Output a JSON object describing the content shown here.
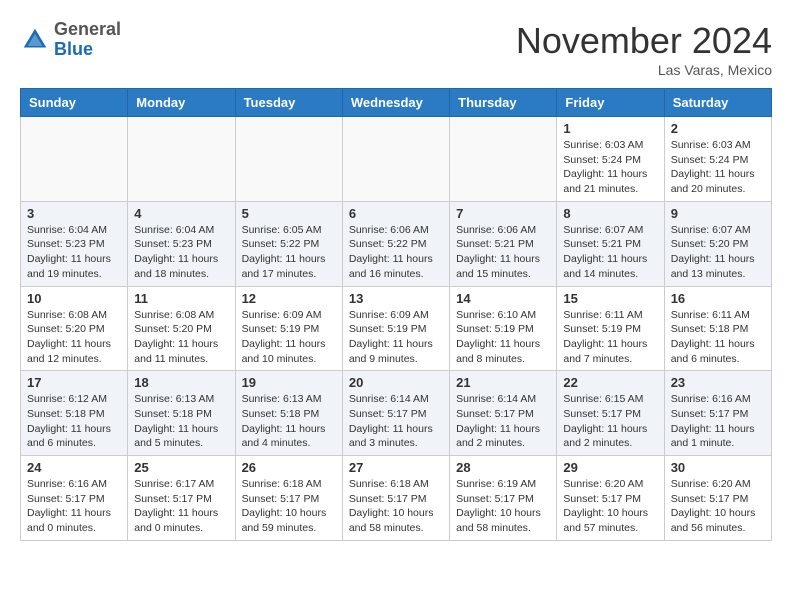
{
  "logo": {
    "general": "General",
    "blue": "Blue"
  },
  "header": {
    "month": "November 2024",
    "location": "Las Varas, Mexico"
  },
  "weekdays": [
    "Sunday",
    "Monday",
    "Tuesday",
    "Wednesday",
    "Thursday",
    "Friday",
    "Saturday"
  ],
  "weeks": [
    {
      "days": [
        {
          "number": "",
          "empty": true
        },
        {
          "number": "",
          "empty": true
        },
        {
          "number": "",
          "empty": true
        },
        {
          "number": "",
          "empty": true
        },
        {
          "number": "",
          "empty": true
        },
        {
          "number": "1",
          "sunrise": "Sunrise: 6:03 AM",
          "sunset": "Sunset: 5:24 PM",
          "daylight": "Daylight: 11 hours and 21 minutes."
        },
        {
          "number": "2",
          "sunrise": "Sunrise: 6:03 AM",
          "sunset": "Sunset: 5:24 PM",
          "daylight": "Daylight: 11 hours and 20 minutes."
        }
      ]
    },
    {
      "days": [
        {
          "number": "3",
          "sunrise": "Sunrise: 6:04 AM",
          "sunset": "Sunset: 5:23 PM",
          "daylight": "Daylight: 11 hours and 19 minutes."
        },
        {
          "number": "4",
          "sunrise": "Sunrise: 6:04 AM",
          "sunset": "Sunset: 5:23 PM",
          "daylight": "Daylight: 11 hours and 18 minutes."
        },
        {
          "number": "5",
          "sunrise": "Sunrise: 6:05 AM",
          "sunset": "Sunset: 5:22 PM",
          "daylight": "Daylight: 11 hours and 17 minutes."
        },
        {
          "number": "6",
          "sunrise": "Sunrise: 6:06 AM",
          "sunset": "Sunset: 5:22 PM",
          "daylight": "Daylight: 11 hours and 16 minutes."
        },
        {
          "number": "7",
          "sunrise": "Sunrise: 6:06 AM",
          "sunset": "Sunset: 5:21 PM",
          "daylight": "Daylight: 11 hours and 15 minutes."
        },
        {
          "number": "8",
          "sunrise": "Sunrise: 6:07 AM",
          "sunset": "Sunset: 5:21 PM",
          "daylight": "Daylight: 11 hours and 14 minutes."
        },
        {
          "number": "9",
          "sunrise": "Sunrise: 6:07 AM",
          "sunset": "Sunset: 5:20 PM",
          "daylight": "Daylight: 11 hours and 13 minutes."
        }
      ]
    },
    {
      "days": [
        {
          "number": "10",
          "sunrise": "Sunrise: 6:08 AM",
          "sunset": "Sunset: 5:20 PM",
          "daylight": "Daylight: 11 hours and 12 minutes."
        },
        {
          "number": "11",
          "sunrise": "Sunrise: 6:08 AM",
          "sunset": "Sunset: 5:20 PM",
          "daylight": "Daylight: 11 hours and 11 minutes."
        },
        {
          "number": "12",
          "sunrise": "Sunrise: 6:09 AM",
          "sunset": "Sunset: 5:19 PM",
          "daylight": "Daylight: 11 hours and 10 minutes."
        },
        {
          "number": "13",
          "sunrise": "Sunrise: 6:09 AM",
          "sunset": "Sunset: 5:19 PM",
          "daylight": "Daylight: 11 hours and 9 minutes."
        },
        {
          "number": "14",
          "sunrise": "Sunrise: 6:10 AM",
          "sunset": "Sunset: 5:19 PM",
          "daylight": "Daylight: 11 hours and 8 minutes."
        },
        {
          "number": "15",
          "sunrise": "Sunrise: 6:11 AM",
          "sunset": "Sunset: 5:19 PM",
          "daylight": "Daylight: 11 hours and 7 minutes."
        },
        {
          "number": "16",
          "sunrise": "Sunrise: 6:11 AM",
          "sunset": "Sunset: 5:18 PM",
          "daylight": "Daylight: 11 hours and 6 minutes."
        }
      ]
    },
    {
      "days": [
        {
          "number": "17",
          "sunrise": "Sunrise: 6:12 AM",
          "sunset": "Sunset: 5:18 PM",
          "daylight": "Daylight: 11 hours and 6 minutes."
        },
        {
          "number": "18",
          "sunrise": "Sunrise: 6:13 AM",
          "sunset": "Sunset: 5:18 PM",
          "daylight": "Daylight: 11 hours and 5 minutes."
        },
        {
          "number": "19",
          "sunrise": "Sunrise: 6:13 AM",
          "sunset": "Sunset: 5:18 PM",
          "daylight": "Daylight: 11 hours and 4 minutes."
        },
        {
          "number": "20",
          "sunrise": "Sunrise: 6:14 AM",
          "sunset": "Sunset: 5:17 PM",
          "daylight": "Daylight: 11 hours and 3 minutes."
        },
        {
          "number": "21",
          "sunrise": "Sunrise: 6:14 AM",
          "sunset": "Sunset: 5:17 PM",
          "daylight": "Daylight: 11 hours and 2 minutes."
        },
        {
          "number": "22",
          "sunrise": "Sunrise: 6:15 AM",
          "sunset": "Sunset: 5:17 PM",
          "daylight": "Daylight: 11 hours and 2 minutes."
        },
        {
          "number": "23",
          "sunrise": "Sunrise: 6:16 AM",
          "sunset": "Sunset: 5:17 PM",
          "daylight": "Daylight: 11 hours and 1 minute."
        }
      ]
    },
    {
      "days": [
        {
          "number": "24",
          "sunrise": "Sunrise: 6:16 AM",
          "sunset": "Sunset: 5:17 PM",
          "daylight": "Daylight: 11 hours and 0 minutes."
        },
        {
          "number": "25",
          "sunrise": "Sunrise: 6:17 AM",
          "sunset": "Sunset: 5:17 PM",
          "daylight": "Daylight: 11 hours and 0 minutes."
        },
        {
          "number": "26",
          "sunrise": "Sunrise: 6:18 AM",
          "sunset": "Sunset: 5:17 PM",
          "daylight": "Daylight: 10 hours and 59 minutes."
        },
        {
          "number": "27",
          "sunrise": "Sunrise: 6:18 AM",
          "sunset": "Sunset: 5:17 PM",
          "daylight": "Daylight: 10 hours and 58 minutes."
        },
        {
          "number": "28",
          "sunrise": "Sunrise: 6:19 AM",
          "sunset": "Sunset: 5:17 PM",
          "daylight": "Daylight: 10 hours and 58 minutes."
        },
        {
          "number": "29",
          "sunrise": "Sunrise: 6:20 AM",
          "sunset": "Sunset: 5:17 PM",
          "daylight": "Daylight: 10 hours and 57 minutes."
        },
        {
          "number": "30",
          "sunrise": "Sunrise: 6:20 AM",
          "sunset": "Sunset: 5:17 PM",
          "daylight": "Daylight: 10 hours and 56 minutes."
        }
      ]
    }
  ]
}
